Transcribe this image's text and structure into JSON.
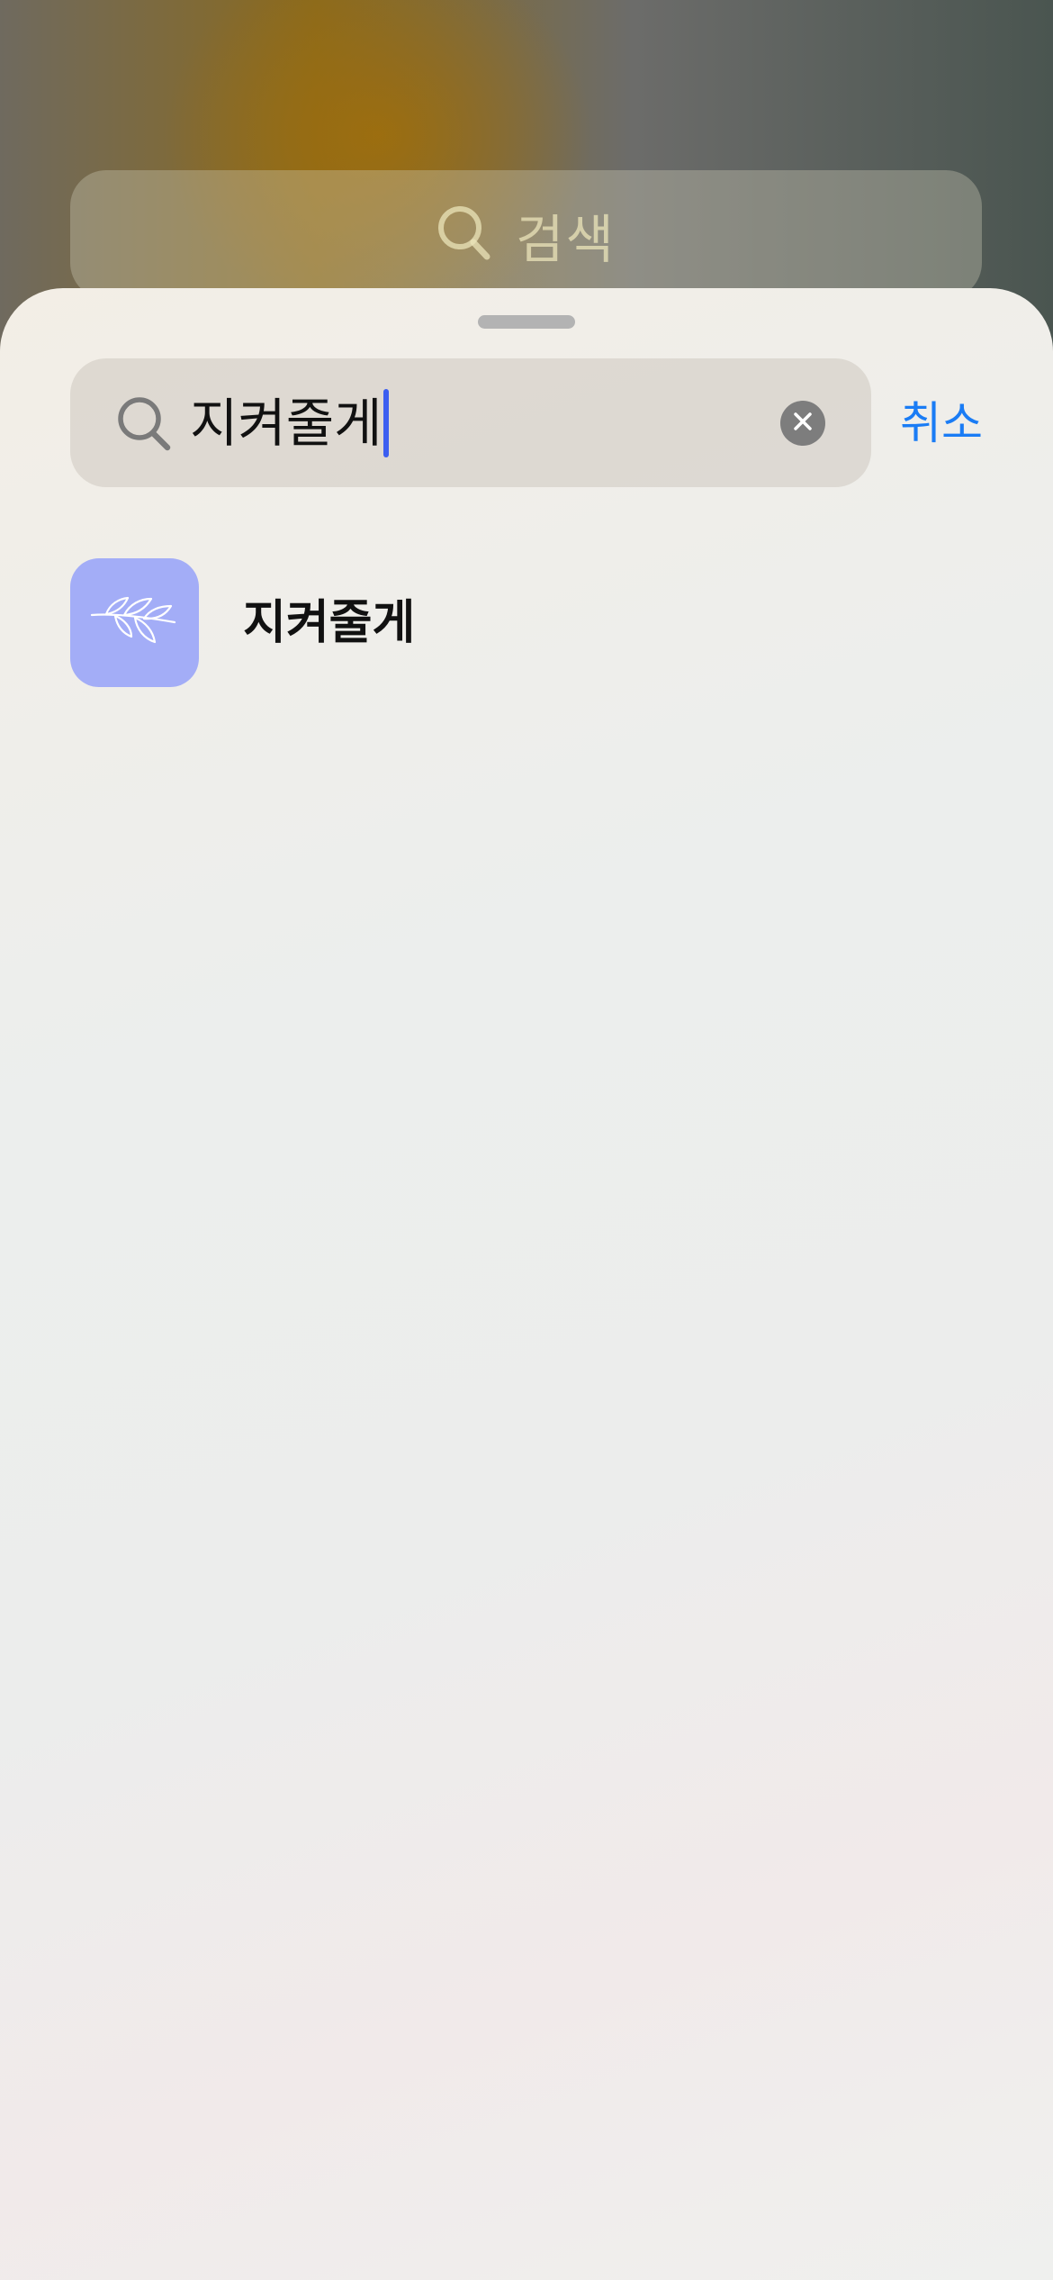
{
  "background_search": {
    "placeholder": "검색",
    "icon": "search-icon"
  },
  "search": {
    "value": "지켜줄게",
    "icon": "search-icon",
    "clear_icon": "clear-icon",
    "cancel_label": "취소"
  },
  "results": [
    {
      "title": "지켜줄게",
      "icon": "leaf-branch-icon",
      "icon_color": "#a3adf7"
    }
  ],
  "colors": {
    "accent": "#1a7cf5",
    "caret": "#3b5ef0"
  }
}
